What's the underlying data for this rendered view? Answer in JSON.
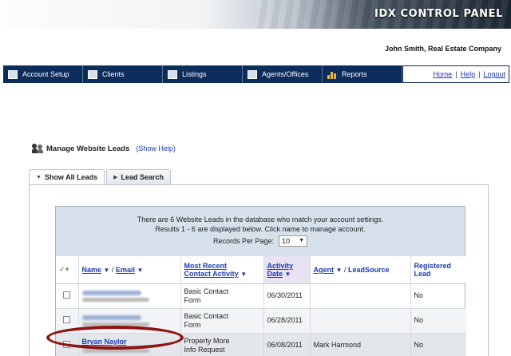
{
  "header": {
    "title": "IDX CONTROL PANEL",
    "company": "John Smith, Real Estate Company"
  },
  "nav": {
    "items": [
      {
        "label": "Account Setup",
        "icon": "computer-icon"
      },
      {
        "label": "Clients",
        "icon": "contact-card-icon"
      },
      {
        "label": "Listings",
        "icon": "window-icon"
      },
      {
        "label": "Agents/Offices",
        "icon": "agents-icon"
      },
      {
        "label": "Reports",
        "icon": "bar-chart-icon"
      }
    ],
    "links": {
      "home": "Home",
      "help": "Help",
      "logout": "Logout",
      "sep": "|"
    }
  },
  "page": {
    "title": "Manage Website Leads",
    "help": "(Show Help)"
  },
  "tabs": [
    {
      "label": "Show All Leads"
    },
    {
      "label": "Lead Search"
    }
  ],
  "info": {
    "line1": "There are 6 Website Leads in the database who match your account settings.",
    "line2": "Results 1 - 6 are displayed below. Click name to manage account.",
    "rpp_label": "Records Per Page:",
    "rpp_value": "10"
  },
  "table": {
    "headers": {
      "check": "✓+",
      "name": "Name",
      "slash1": "/",
      "email": "Email",
      "activity_line1": "Most Recent",
      "activity_line2": "Contact Activity",
      "date_line1": "Activity",
      "date_line2": "Date",
      "agent": "Agent",
      "slash2": "/",
      "leadsource": "LeadSource",
      "registered_line1": "Registered",
      "registered_line2": "Lead"
    },
    "rows": [
      {
        "name": "",
        "activity_line1": "Basic Contact",
        "activity_line2": "Form",
        "date": "06/30/2011",
        "agent": "",
        "registered": "No"
      },
      {
        "name": "",
        "activity_line1": "Basic Contact",
        "activity_line2": "Form",
        "date": "06/28/2011",
        "agent": "",
        "registered": "No"
      },
      {
        "name": "Bryan Naylor",
        "activity_line1": "Property More",
        "activity_line2": "Info Request",
        "date": "06/08/2011",
        "agent": "Mark Harmond",
        "registered": "No"
      }
    ]
  },
  "colors": {
    "navbar": "#0c2c5c",
    "link": "#1a3bb0",
    "info_bg": "#d6e1eb",
    "highlight": "#8e1414"
  }
}
